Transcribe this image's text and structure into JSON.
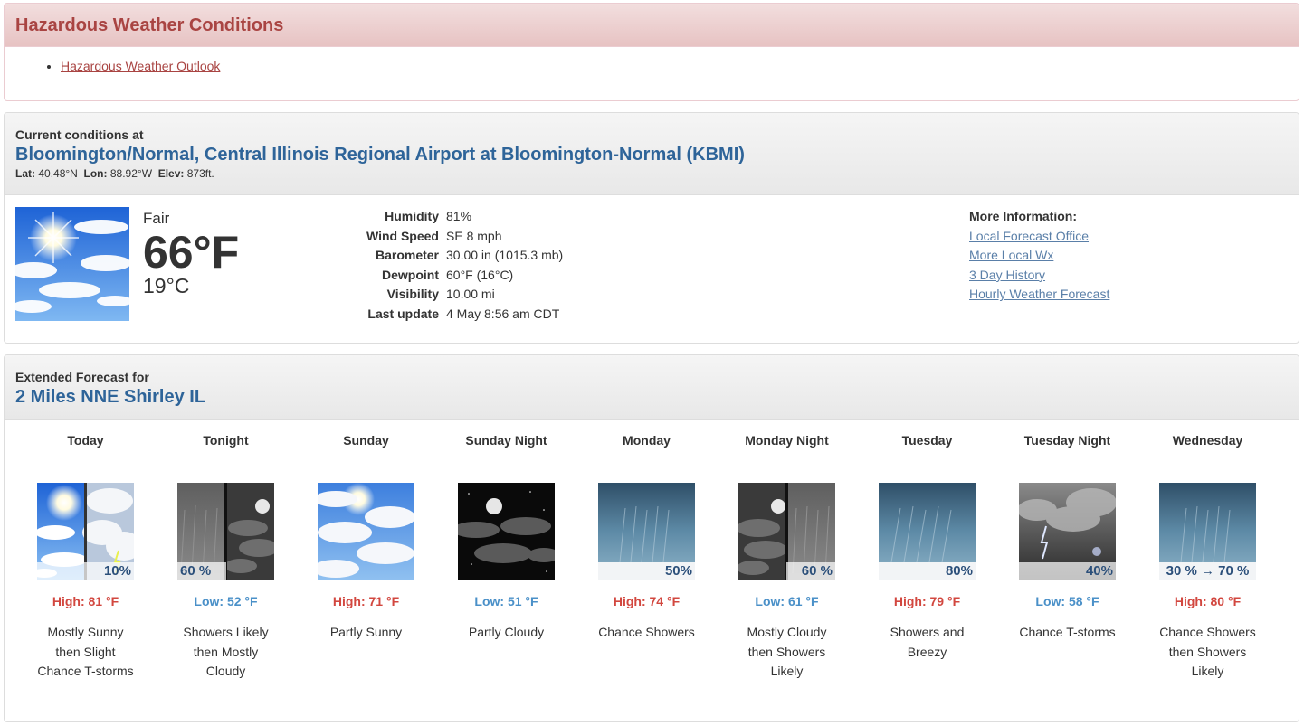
{
  "hazard": {
    "title": "Hazardous Weather Conditions",
    "items": [
      "Hazardous Weather Outlook"
    ]
  },
  "current": {
    "lead": "Current conditions at",
    "station": "Bloomington/Normal, Central Illinois Regional Airport at Bloomington-Normal (KBMI)",
    "lat_label": "Lat:",
    "lat": "40.48°N",
    "lon_label": "Lon:",
    "lon": "88.92°W",
    "elev_label": "Elev:",
    "elev": "873ft.",
    "sky": "Fair",
    "temp_f": "66°F",
    "temp_c": "19°C",
    "details": [
      {
        "k": "Humidity",
        "v": "81%"
      },
      {
        "k": "Wind Speed",
        "v": "SE 8 mph"
      },
      {
        "k": "Barometer",
        "v": "30.00 in (1015.3 mb)"
      },
      {
        "k": "Dewpoint",
        "v": "60°F (16°C)"
      },
      {
        "k": "Visibility",
        "v": "10.00 mi"
      },
      {
        "k": "Last update",
        "v": "4 May 8:56 am CDT"
      }
    ],
    "more_title": "More Information:",
    "links": [
      "Local Forecast Office",
      "More Local Wx",
      "3 Day History",
      "Hourly Weather Forecast"
    ]
  },
  "extended": {
    "lead": "Extended Forecast for",
    "place": "2 Miles NNE Shirley IL",
    "periods": [
      {
        "name": "Today",
        "icon": "sunny-then-tstorm-icon",
        "pop": "10%",
        "temp": "High: 81 °F",
        "kind": "hi",
        "desc": "Mostly Sunny then Slight Chance T-storms"
      },
      {
        "name": "Tonight",
        "icon": "showers-then-cloudy-night-icon",
        "pop": "60 %",
        "temp": "Low: 52 °F",
        "kind": "lo",
        "desc": "Showers Likely then Mostly Cloudy"
      },
      {
        "name": "Sunday",
        "icon": "partly-sunny-icon",
        "pop": "",
        "temp": "High: 71 °F",
        "kind": "hi",
        "desc": "Partly Sunny"
      },
      {
        "name": "Sunday Night",
        "icon": "partly-cloudy-night-icon",
        "pop": "",
        "temp": "Low: 51 °F",
        "kind": "lo",
        "desc": "Partly Cloudy"
      },
      {
        "name": "Monday",
        "icon": "showers-icon",
        "pop": "50%",
        "temp": "High: 74 °F",
        "kind": "hi",
        "desc": "Chance Showers"
      },
      {
        "name": "Monday Night",
        "icon": "cloudy-then-showers-night-icon",
        "pop": "60 %",
        "temp": "Low: 61 °F",
        "kind": "lo",
        "desc": "Mostly Cloudy then Showers Likely"
      },
      {
        "name": "Tuesday",
        "icon": "showers-breezy-icon",
        "pop": "80%",
        "temp": "High: 79 °F",
        "kind": "hi",
        "desc": "Showers and Breezy"
      },
      {
        "name": "Tuesday Night",
        "icon": "tstorm-night-icon",
        "pop": "40%",
        "temp": "Low: 58 °F",
        "kind": "lo",
        "desc": "Chance T-storms"
      },
      {
        "name": "Wednesday",
        "icon": "showers-icon",
        "pop": "30 % → 70 %",
        "temp": "High: 80 °F",
        "kind": "hi",
        "desc": "Chance Showers then Showers Likely"
      }
    ]
  }
}
